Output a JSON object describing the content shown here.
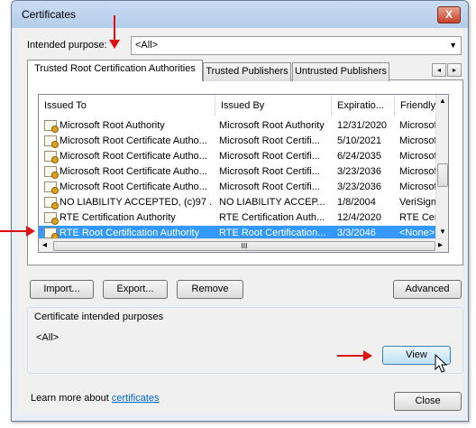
{
  "window": {
    "title": "Certificates",
    "close_glyph": "X"
  },
  "purpose": {
    "label": "Intended purpose:",
    "value": "<All>"
  },
  "tabs": [
    "Trusted Root Certification Authorities",
    "Trusted Publishers",
    "Untrusted Publishers"
  ],
  "tab_scroll": {
    "left": "◂",
    "right": "▸"
  },
  "table": {
    "columns": [
      "Issued To",
      "Issued By",
      "Expiratio...",
      "Friendly"
    ],
    "rows": [
      [
        "Microsoft Root Authority",
        "Microsoft Root Authority",
        "12/31/2020",
        "Microsof"
      ],
      [
        "Microsoft Root Certificate Autho...",
        "Microsoft Root Certifi...",
        "5/10/2021",
        "Microsof"
      ],
      [
        "Microsoft Root Certificate Autho...",
        "Microsoft Root Certifi...",
        "6/24/2035",
        "Microsof"
      ],
      [
        "Microsoft Root Certificate Autho...",
        "Microsoft Root Certifi...",
        "3/23/2036",
        "Microsof"
      ],
      [
        "Microsoft Root Certificate Autho...",
        "Microsoft Root Certifi...",
        "3/23/2036",
        "Microsof"
      ],
      [
        "NO LIABILITY ACCEPTED, (c)97 ...",
        "NO LIABILITY ACCEP...",
        "1/8/2004",
        "VeriSign"
      ],
      [
        "RTE Certification Authority",
        "RTE Certification Auth...",
        "12/4/2020",
        "RTE Cer"
      ],
      [
        "RTE Root Certification Authority",
        "RTE Root Certification...",
        "3/3/2046",
        "<None>"
      ]
    ],
    "selected_row_index": 7,
    "hscroll_grip": "III",
    "scroll_up": "▲",
    "scroll_down": "▼",
    "scroll_left": "◂",
    "scroll_right": "▸"
  },
  "buttons": {
    "import": "Import...",
    "export": "Export...",
    "remove": "Remove",
    "advanced": "Advanced",
    "view": "View",
    "close": "Close"
  },
  "purposes_group": {
    "label": "Certificate intended purposes",
    "value": "<All>"
  },
  "learn_more": {
    "text": "Learn more about ",
    "link": "certificates"
  },
  "icons": [
    "certificate-icon",
    "dropdown-arrow-icon",
    "mouse-cursor-icon",
    "red-arrow-annotation"
  ],
  "colors": {
    "selection": "#3399ff",
    "annotation": "#dd1111",
    "link": "#0066cc"
  }
}
